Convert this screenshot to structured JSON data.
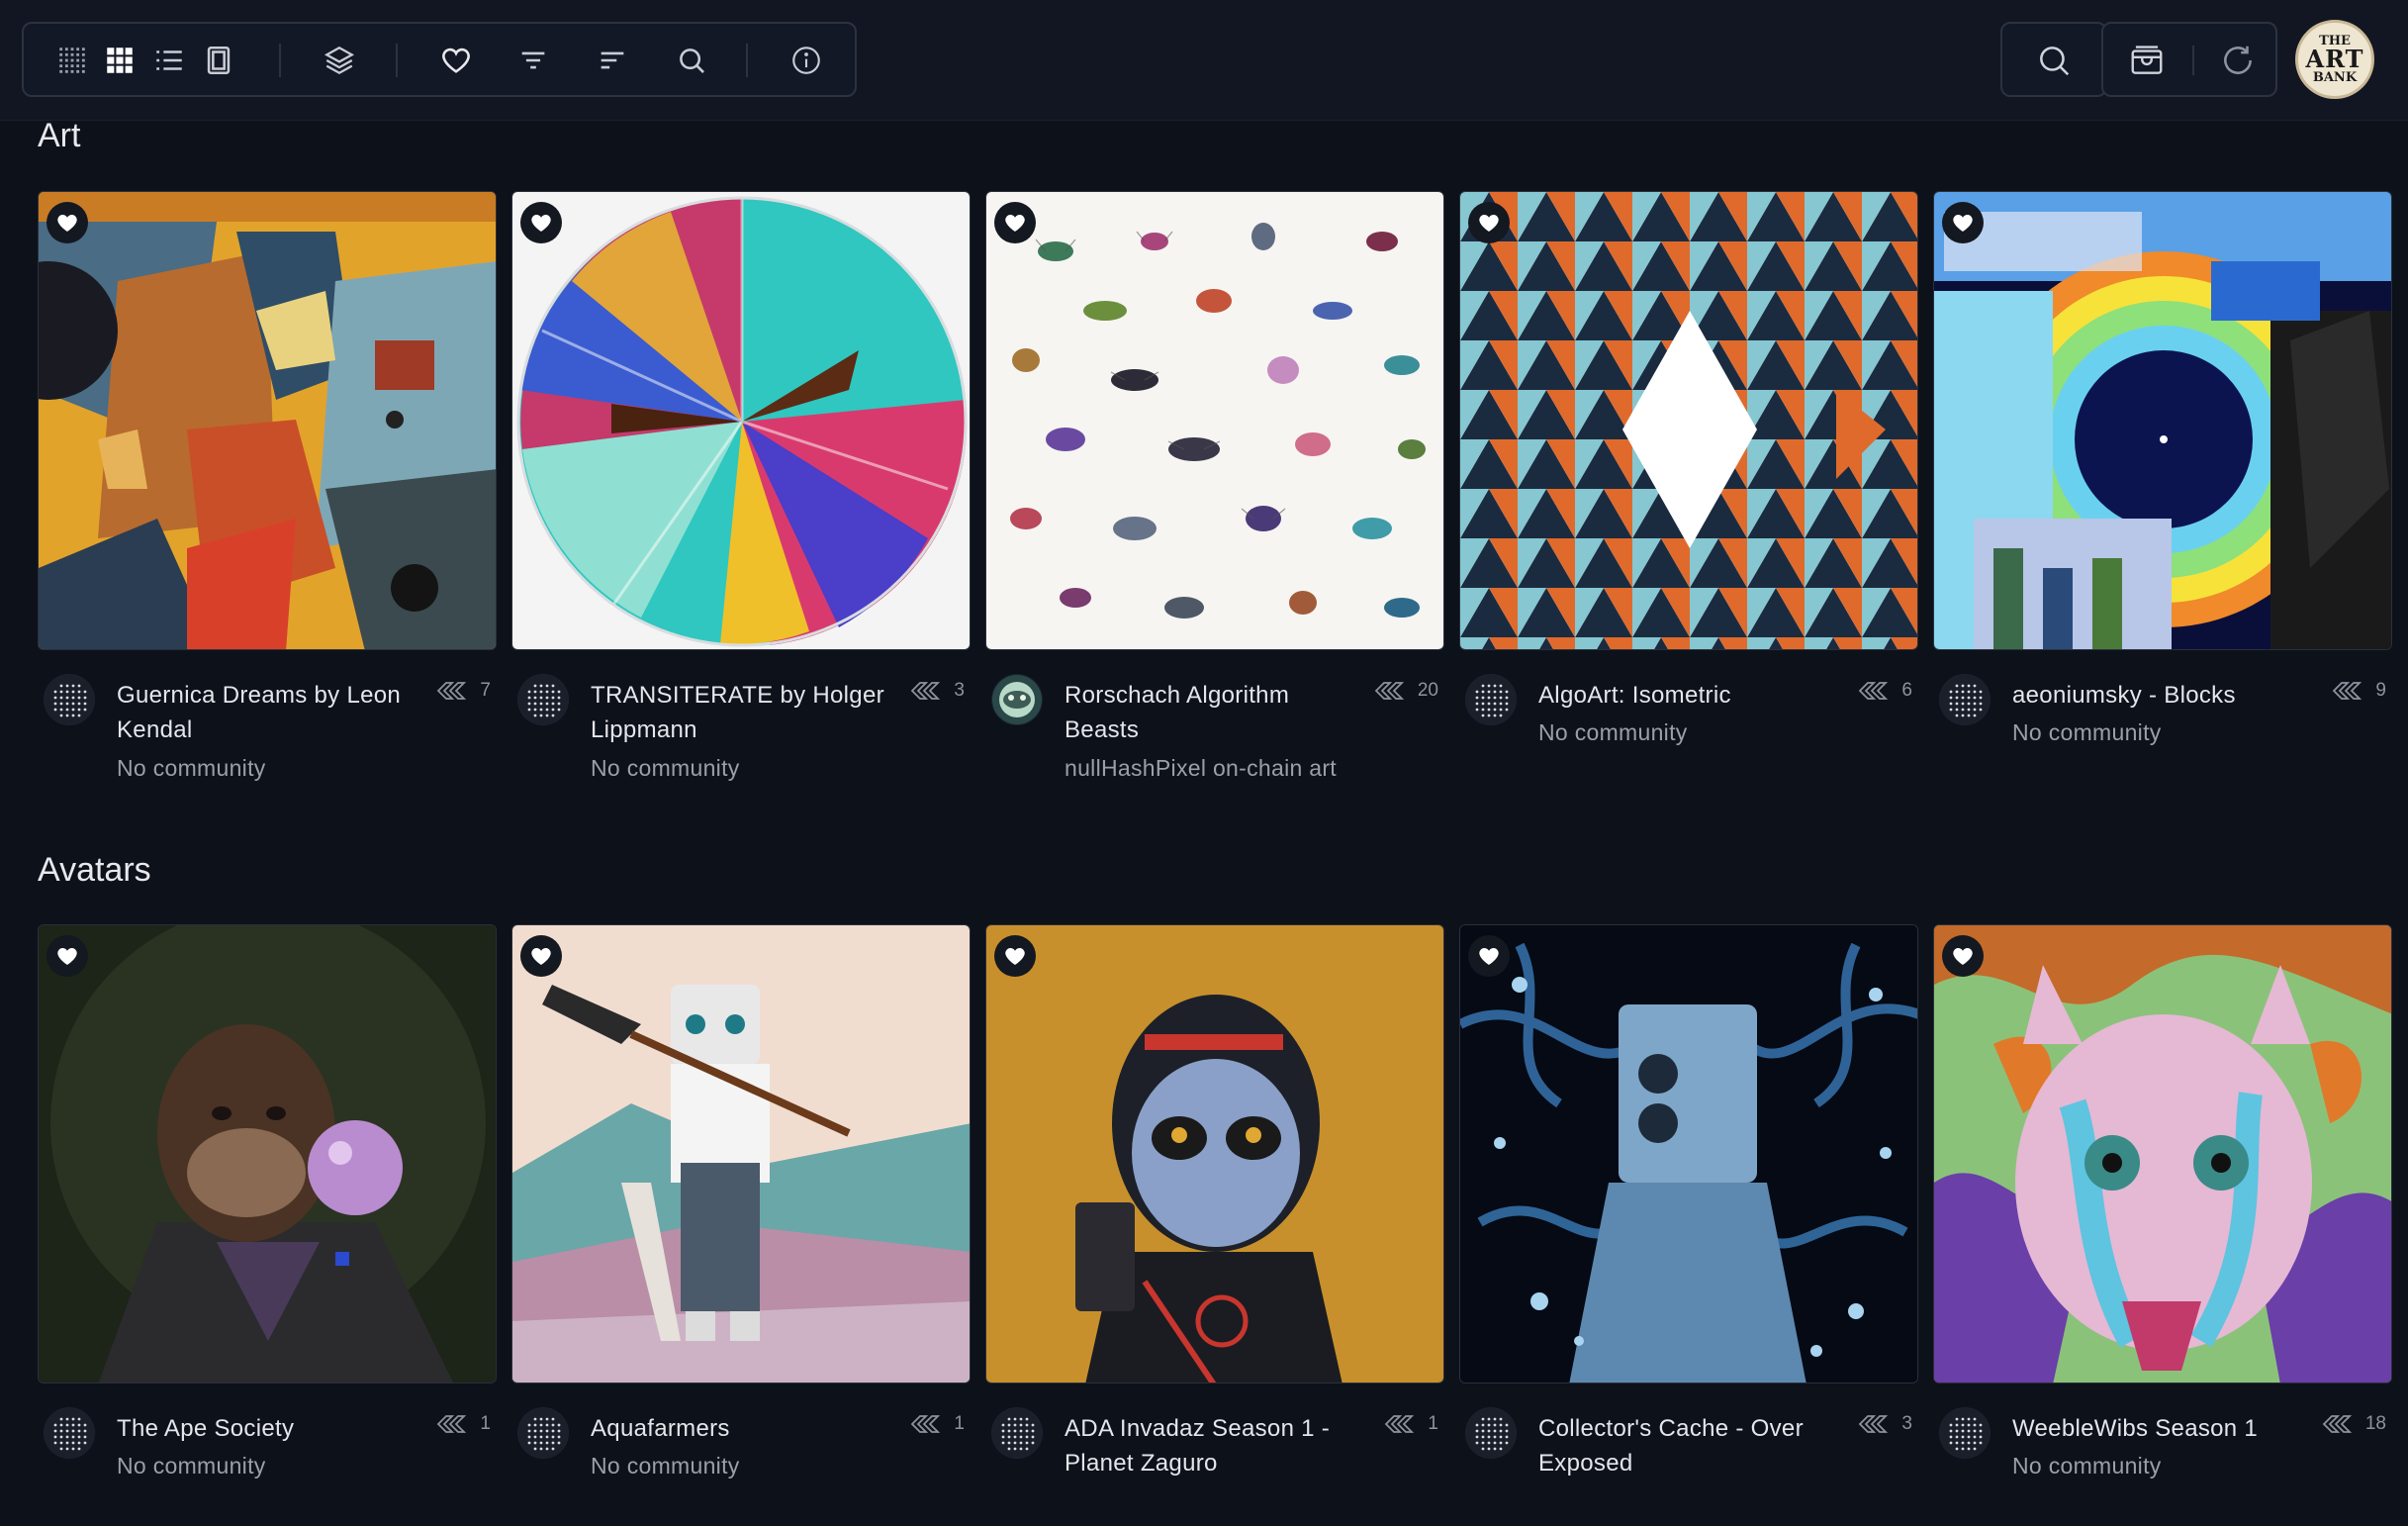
{
  "toolbar": {
    "left_icons": [
      "grid-dense-icon",
      "grid-icon",
      "list-icon",
      "single-view-icon",
      "layers-icon",
      "heart-icon",
      "filter-icon",
      "sort-icon",
      "search-icon",
      "info-icon"
    ],
    "right_icons": [
      "search-icon",
      "wallet-icon",
      "refresh-icon"
    ],
    "avatar": {
      "line1": "THE",
      "line2": "ART",
      "line3": "BANK"
    }
  },
  "sections": [
    {
      "title": "Art",
      "cards": [
        {
          "name": "Guernica Dreams by Leon Kendal",
          "sub": "No community",
          "count": "7"
        },
        {
          "name": "TRANSITERATE by Holger Lippmann",
          "sub": "No community",
          "count": "3"
        },
        {
          "name": "Rorschach Algorithm Beasts",
          "sub": "nullHashPixel on-chain art",
          "count": "20"
        },
        {
          "name": "AlgoArt: Isometric",
          "sub": "No community",
          "count": "6"
        },
        {
          "name": "aeoniumsky - Blocks",
          "sub": "No community",
          "count": "9"
        }
      ]
    },
    {
      "title": "Avatars",
      "cards": [
        {
          "name": "The Ape Society",
          "sub": "No community",
          "count": "1"
        },
        {
          "name": "Aquafarmers",
          "sub": "No community",
          "count": "1"
        },
        {
          "name": "ADA Invadaz Season 1 - Planet Zaguro",
          "sub": "",
          "count": "1"
        },
        {
          "name": "Collector's Cache - Over Exposed",
          "sub": "",
          "count": "3"
        },
        {
          "name": "WeebleWibs Season 1",
          "sub": "No community",
          "count": "18"
        }
      ]
    }
  ],
  "colors": {
    "background": "#0d111a",
    "topbar": "#111622",
    "border": "#2c3240",
    "muted_text": "#9aa0aa"
  }
}
